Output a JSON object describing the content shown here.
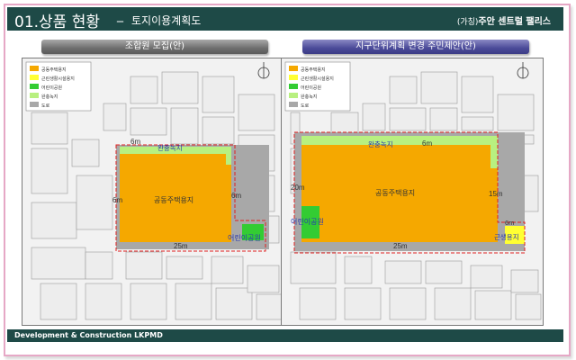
{
  "header": {
    "title": "01.상품 현황",
    "dash": "_",
    "subtitle": "토지이용계획도",
    "right_paren": "(가칭)",
    "right_name": "주안 센트럴 팰리스"
  },
  "panels": {
    "left_label": "조합원 모집(안)",
    "right_label": "지구단위계획 변경 주민제안(안)"
  },
  "legend": {
    "items": [
      {
        "label": "공동주택용지",
        "color": "#f5a800"
      },
      {
        "label": "근린생활시설용지",
        "color": "#ffff33"
      },
      {
        "label": "어린이공원",
        "color": "#33cc33"
      },
      {
        "label": "완충녹지",
        "color": "#b8f080"
      },
      {
        "label": "도로",
        "color": "#a8a8a8"
      }
    ]
  },
  "left_map": {
    "zone_label": "공동주택용지",
    "buffer_label": "완충녹지",
    "park_label": "어린이공원",
    "dim_top": "6m",
    "dim_left": "6m",
    "dim_right": "6m",
    "dim_bottom": "25m"
  },
  "right_map": {
    "zone_label": "공동주택용지",
    "buffer_label": "완충녹지",
    "park_label": "어린이공원",
    "facility_label": "근생용지",
    "dim_top": "6m",
    "dim_left": "20m",
    "dim_right": "15m",
    "dim_corner": "6m",
    "dim_bottom": "25m"
  },
  "footer": {
    "text": "Development & Construction LKPMD"
  }
}
